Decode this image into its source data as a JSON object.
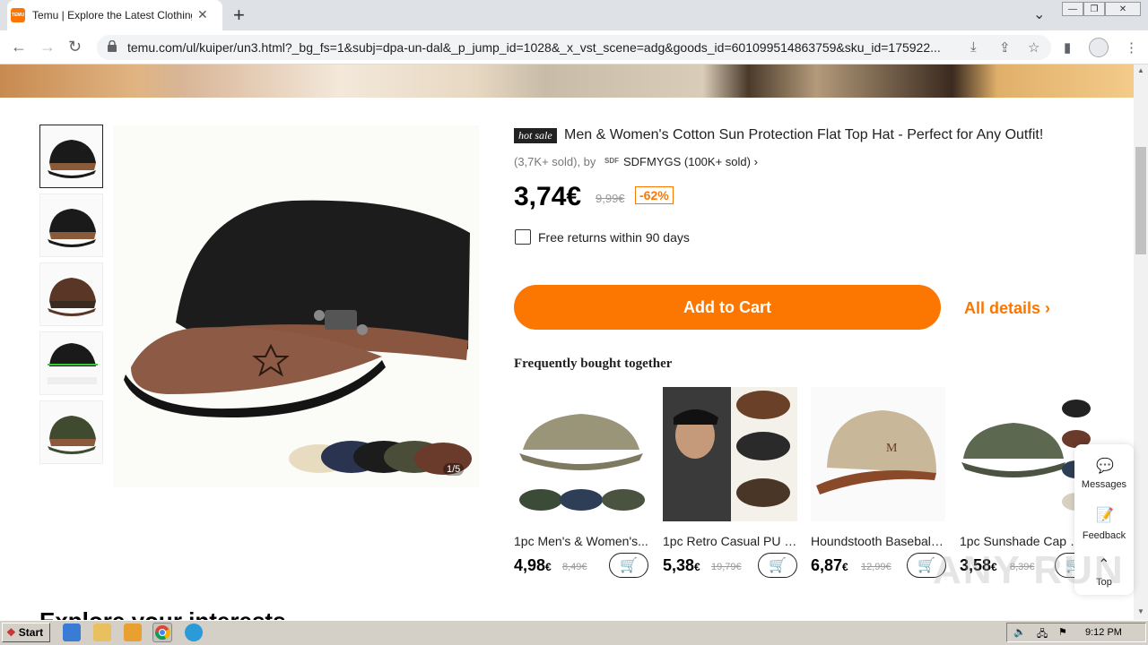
{
  "browser": {
    "tab_title": "Temu | Explore the Latest Clothing, B",
    "favicon_text": "TEMU",
    "url": "temu.com/ul/kuiper/un3.html?_bg_fs=1&subj=dpa-un-dal&_p_jump_id=1028&_x_vst_scene=adg&goods_id=601099514863759&sku_id=175922..."
  },
  "product": {
    "badge": "hot sale",
    "title": "Men & Women's Cotton Sun Protection Flat Top Hat - Perfect for Any Outfit!",
    "sold_by": "(3,7K+ sold), by",
    "store_logo": "SDF",
    "store": "SDFMYGS (100K+ sold)",
    "price": "3,74€",
    "original_price": "9,99€",
    "discount": "-62%",
    "returns": "Free returns within 90 days",
    "add_to_cart": "Add to Cart",
    "all_details": "All details",
    "image_counter": "1/5"
  },
  "fbt": {
    "heading": "Frequently bought together",
    "items": [
      {
        "name": "1pc Men's & Women's...",
        "price": "4,98",
        "currency": "€",
        "orig": "8,49€"
      },
      {
        "name": "1pc Retro Casual PU L...",
        "price": "5,38",
        "currency": "€",
        "orig": "19,79€"
      },
      {
        "name": "Houndstooth Baseball ...",
        "price": "6,87",
        "currency": "€",
        "orig": "12,99€"
      },
      {
        "name": "1pc Sunshade Cap So...",
        "price": "3,58",
        "currency": "€",
        "orig": "8,39€"
      }
    ]
  },
  "side_panel": {
    "messages": "Messages",
    "feedback": "Feedback",
    "top": "Top"
  },
  "explore_heading": "Explore your interests",
  "watermark": "ANY RUN",
  "taskbar": {
    "start": "Start",
    "clock": "9:12 PM"
  },
  "colors": {
    "accent": "#fb7701"
  }
}
